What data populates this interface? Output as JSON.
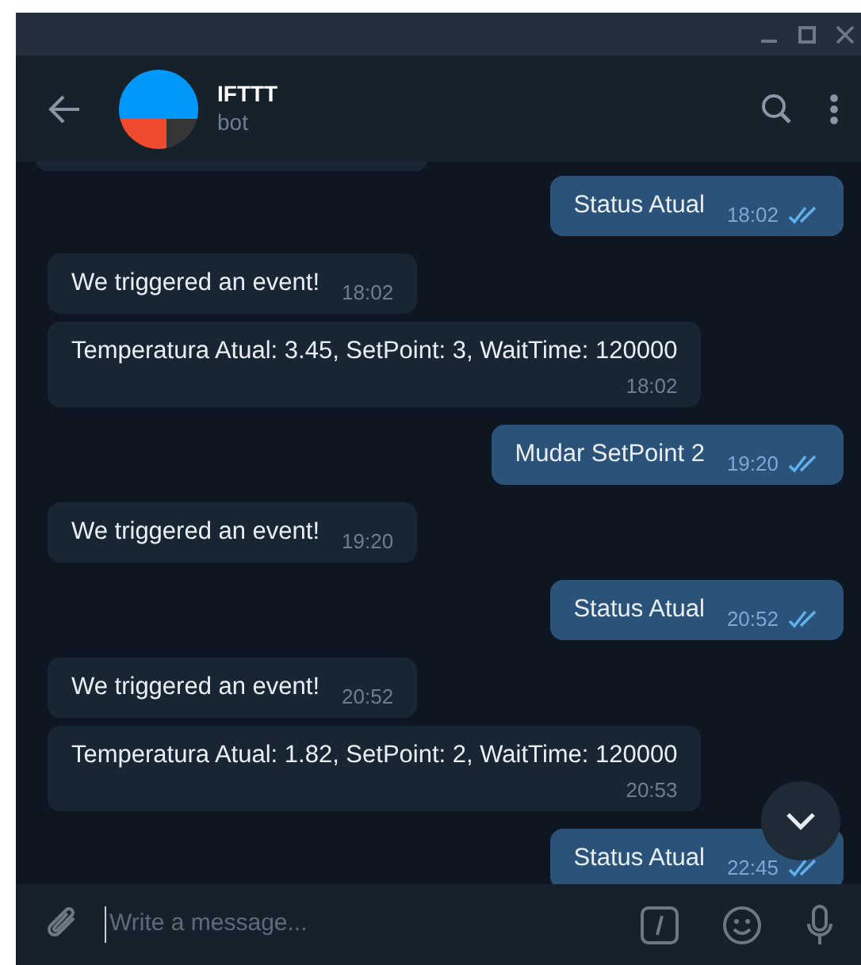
{
  "chat": {
    "name": "IFTTT",
    "status": "bot"
  },
  "messages": [
    {
      "kind": "sent",
      "text": "Status Atual",
      "time": "18:02",
      "read": true
    },
    {
      "kind": "received",
      "text": "We triggered an event!",
      "time": "18:02"
    },
    {
      "kind": "report",
      "text": "Temperatura Atual: 3.45, SetPoint: 3, WaitTime: 120000",
      "time": "18:02"
    },
    {
      "kind": "sent",
      "text": "Mudar SetPoint 2",
      "time": "19:20",
      "read": true
    },
    {
      "kind": "received",
      "text": "We triggered an event!",
      "time": "19:20"
    },
    {
      "kind": "sent",
      "text": "Status Atual",
      "time": "20:52",
      "read": true
    },
    {
      "kind": "received",
      "text": "We triggered an event!",
      "time": "20:52"
    },
    {
      "kind": "report",
      "text": "Temperatura Atual: 1.82, SetPoint: 2, WaitTime: 120000",
      "time": "20:53"
    },
    {
      "kind": "sent",
      "text": "Status Atual",
      "time": "22:45",
      "read": true
    }
  ],
  "composer": {
    "placeholder": "Write a message..."
  }
}
